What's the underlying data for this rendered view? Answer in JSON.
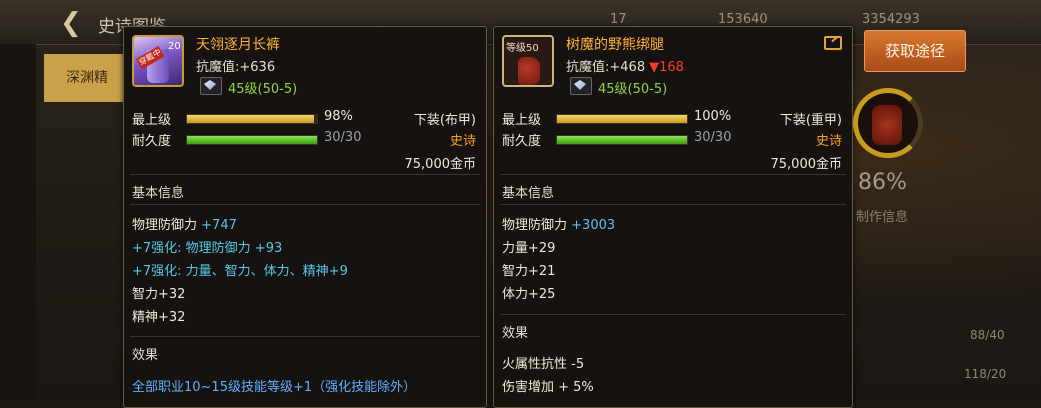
{
  "top": {
    "title": "史诗图鉴",
    "res1": "17",
    "res2": "153640",
    "res3": "3354293"
  },
  "left_tab": "深渊精",
  "card_a": {
    "icon_badge": "穿戴中",
    "icon_num": "20",
    "name": "天翎逐月长裤",
    "anti_label": "抗魔值:",
    "anti_value": "+636",
    "level_range": "45级(50-5)",
    "top_level_label": "最上级",
    "top_level_pct": "98%",
    "top_level_fill": 0.98,
    "slot": "下装(布甲)",
    "durability_label": "耐久度",
    "durability": "30/30",
    "durability_fill": 1.0,
    "rarity": "史诗",
    "price": "75,000金币",
    "basic_info_title": "基本信息",
    "stats": {
      "phys_def": "物理防御力",
      "phys_def_val": "+747",
      "enhance1": "+7强化:  物理防御力 +93",
      "enhance2": "+7强化:  力量、智力、体力、精神+9",
      "int": "智力+32",
      "spirit": "精神+32"
    },
    "effect_title": "效果",
    "effect_text": "全部职业10~15级技能等级+1（强化技能除外）"
  },
  "card_b": {
    "icon_level": "等级50",
    "name": "树魔的野熊绑腿",
    "anti_label": "抗魔值:",
    "anti_value": "+468",
    "anti_diff": "▼168",
    "level_range": "45级(50-5)",
    "top_level_label": "最上级",
    "top_level_pct": "100%",
    "top_level_fill": 1.0,
    "slot": "下装(重甲)",
    "durability_label": "耐久度",
    "durability": "30/30",
    "durability_fill": 1.0,
    "rarity": "史诗",
    "price": "75,000金币",
    "basic_info_title": "基本信息",
    "stats": {
      "phys_def": "物理防御力",
      "phys_def_val": "+3003",
      "str": "力量+29",
      "int": "智力+21",
      "vit": "体力+25"
    },
    "effect_title": "效果",
    "effects": [
      "火属性抗性 -5",
      "伤害增加 + 5%"
    ]
  },
  "get_button": "获取途径",
  "background": {
    "pct": "86%",
    "make_info": "制作信息",
    "num1": "88/40",
    "num2": "118/20"
  }
}
